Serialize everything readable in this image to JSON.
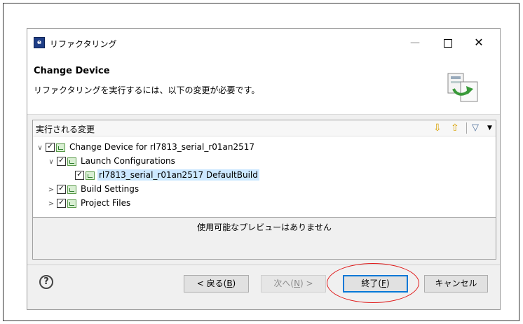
{
  "window": {
    "title": "リファクタリング",
    "icon": "app-icon",
    "controls": [
      "minimize-icon",
      "maximize-icon",
      "close-icon"
    ]
  },
  "header": {
    "title": "Change Device",
    "message": "リファクタリングを実行するには、以下の変更が必要です。",
    "image": "refactor-wizard-image"
  },
  "changes": {
    "label": "実行される変更",
    "toolbar": [
      "down-arrow-icon",
      "up-arrow-icon",
      "filter-icon",
      "view-menu-icon"
    ],
    "tree": [
      {
        "label": "Change Device for rl7813_serial_r01an2517",
        "expanded": true,
        "checked": true,
        "level": 0
      },
      {
        "label": "Launch Configurations",
        "expanded": true,
        "checked": true,
        "level": 1
      },
      {
        "label": "rl7813_serial_r01an2517 DefaultBuild",
        "checked": true,
        "selected": true,
        "level": 2
      },
      {
        "label": "Build Settings",
        "expanded": false,
        "checked": true,
        "level": 1
      },
      {
        "label": "Project Files",
        "expanded": false,
        "checked": true,
        "level": 1
      }
    ]
  },
  "preview": {
    "message": "使用可能なプレビューはありません"
  },
  "buttons": {
    "back": {
      "prefix": "< 戻る(",
      "mnemonic": "B",
      "suffix": ")"
    },
    "next": {
      "prefix": "次へ(",
      "mnemonic": "N",
      "suffix": ") >"
    },
    "finish": {
      "prefix": "終了(",
      "mnemonic": "F",
      "suffix": ")"
    },
    "cancel": "キャンセル"
  },
  "colors": {
    "selection": "#cce8ff",
    "annotation": "#e01a1a",
    "primary_border": "#0078d7"
  }
}
